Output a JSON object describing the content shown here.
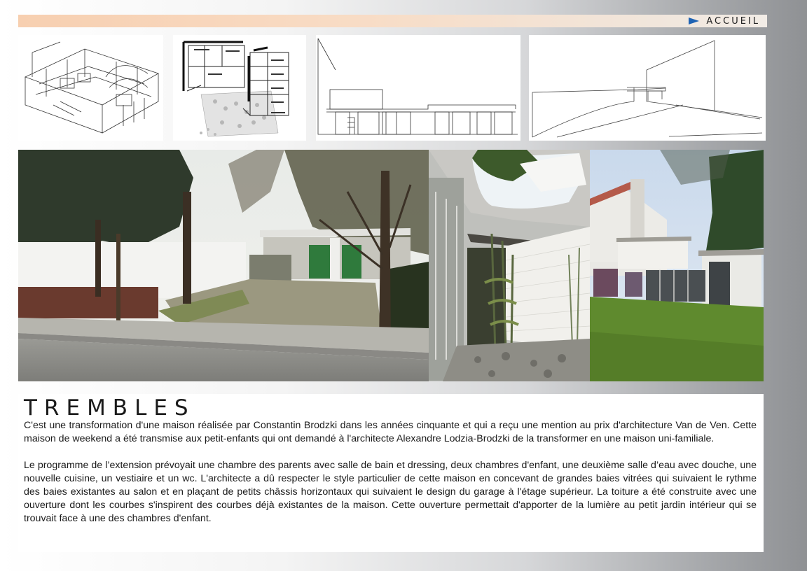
{
  "nav": {
    "home_label": "ACCUEIL",
    "accent_color": "#1f63b4"
  },
  "project": {
    "title": "TREMBLES",
    "paragraphs": [
      "C'est une transformation d'une maison réalisée par Constantin Brodzki dans les années cinquante et qui a reçu une mention au prix d'architecture Van de Ven. Cette maison de weekend a été transmise aux petit-enfants qui ont demandé à l'architecte Alexandre Lodzia-Brodzki de la transformer en une maison uni-familiale.",
      "Le programme de l’extension prévoyait une chambre des parents avec salle de bain et dressing, deux chambres d'enfant, une deuxième salle d’eau avec douche, une nouvelle cuisine, un vestiaire et un wc. L'architecte a dû respecter le style particulier de cette maison en concevant de grandes baies vitrées qui suivaient le rythme des baies existantes au salon et en plaçant de petits châssis horizontaux qui suivaient le design du garage à l'étage supérieur. La toiture a été construite avec une ouverture dont les courbes s'inspirent des courbes déjà existantes de la maison. Cette ouverture permettait d'apporter de la lumière au petit jardin intérieur qui se trouvait face à une des chambres d'enfant."
    ]
  },
  "thumbnails": [
    {
      "name": "isometric-drawing-thumbnail"
    },
    {
      "name": "floor-plan-thumbnail"
    },
    {
      "name": "elevation-drawing-thumbnail"
    },
    {
      "name": "perspective-sketch-thumbnail"
    }
  ],
  "photos": [
    {
      "name": "street-view-photo"
    },
    {
      "name": "courtyard-skylight-photo"
    },
    {
      "name": "garden-facade-photo"
    }
  ]
}
